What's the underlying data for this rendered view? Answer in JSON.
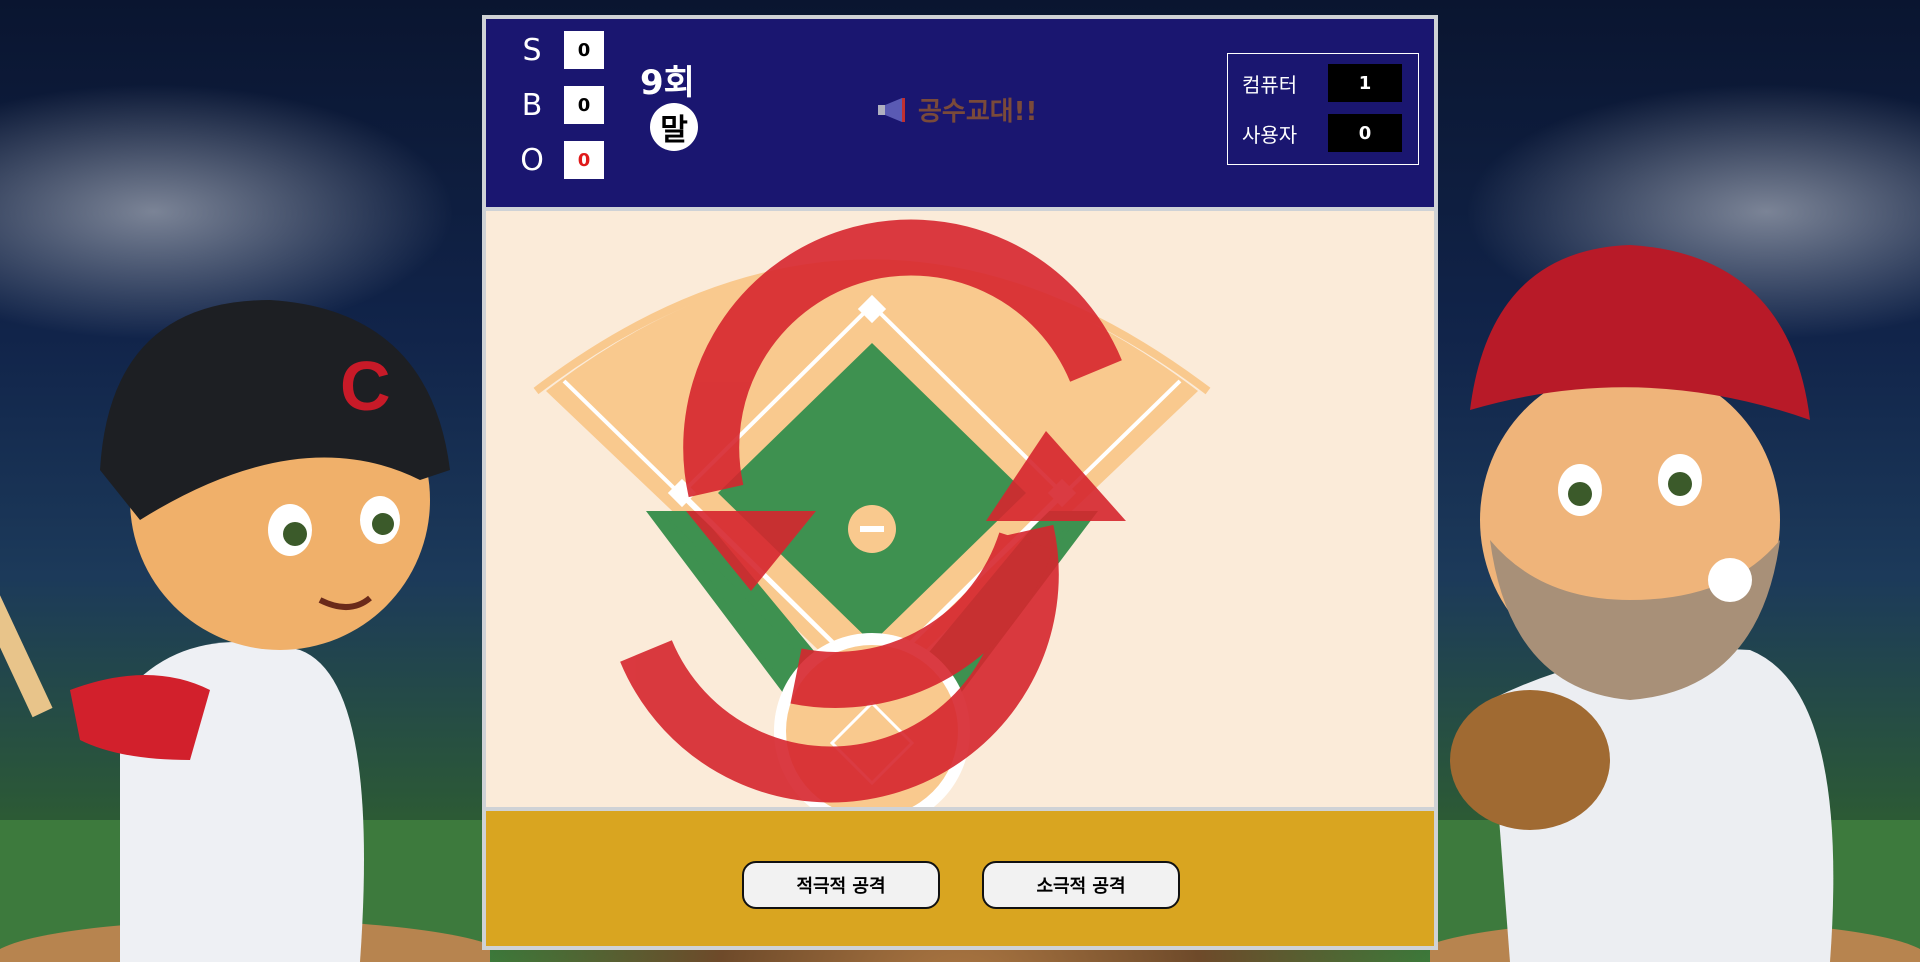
{
  "count": {
    "strike_label": "S",
    "strike_value": "0",
    "ball_label": "B",
    "ball_value": "0",
    "out_label": "O",
    "out_value": "0"
  },
  "inning": {
    "number_label": "9회",
    "half_label": "말"
  },
  "announcement": {
    "text": "공수교대!!",
    "icon": "megaphone-icon"
  },
  "teams": [
    {
      "name": "컴퓨터",
      "score": "1"
    },
    {
      "name": "사용자",
      "score": "0"
    }
  ],
  "field": {
    "overlay_icon": "switch-sides-icon"
  },
  "actions": {
    "aggressive_label": "적극적 공격",
    "passive_label": "소극적 공격"
  },
  "colors": {
    "scoreboard_bg": "#1a1670",
    "action_bar_bg": "#d9a520",
    "grass": "#3e9150",
    "dirt": "#f9c98e",
    "swap_arrow": "#d6262e",
    "out_value_color": "#e01a1a"
  }
}
